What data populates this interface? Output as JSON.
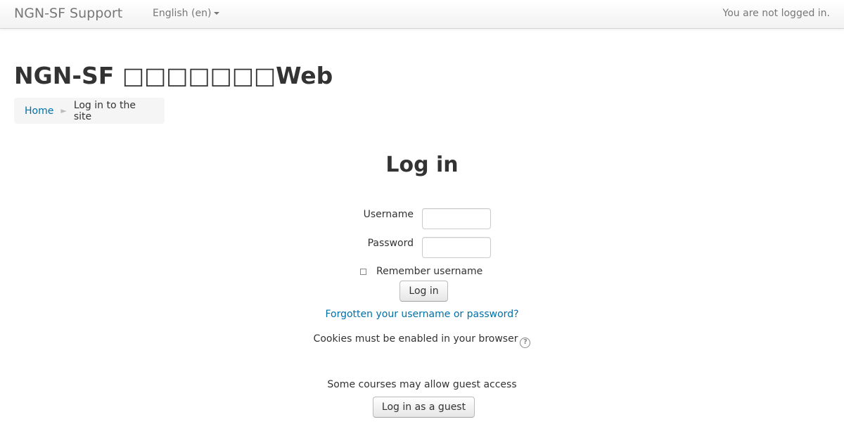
{
  "navbar": {
    "brand": "NGN-SF Support",
    "language": "English (en)",
    "login_status": "You are not logged in."
  },
  "page": {
    "heading": "NGN-SF □□□□□□□Web"
  },
  "breadcrumb": {
    "home": "Home",
    "separator": "►",
    "current": "Log in to the site"
  },
  "login": {
    "title": "Log in",
    "username_label": "Username",
    "username_value": "",
    "password_label": "Password",
    "password_value": "",
    "remember_label": "Remember username",
    "remember_checked": false,
    "submit_label": "Log in",
    "forgot_link": "Forgotten your username or password?",
    "cookies_text": "Cookies must be enabled in your browser",
    "help_icon": "question-circle-icon",
    "help_glyph": "?"
  },
  "guest": {
    "note": "Some courses may allow guest access",
    "button_label": "Log in as a guest"
  },
  "colors": {
    "link": "#0070a8",
    "text": "#333333",
    "muted": "#777777"
  }
}
